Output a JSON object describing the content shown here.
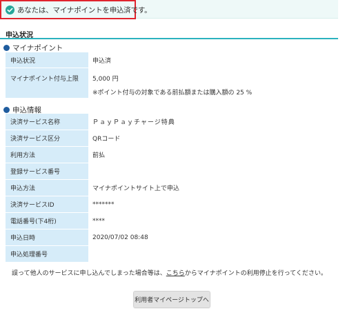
{
  "banner": {
    "message": "あなたは、マイナポイントを申込済です。"
  },
  "section_title": "申込状況",
  "mynapoint": {
    "heading": "マイナポイント",
    "rows": [
      {
        "label": "申込状況",
        "value": "申込済"
      },
      {
        "label": "マイナポイント付与上限",
        "value": "5,000 円",
        "note": "※ポイント付与の対象である前払額または購入額の 25 %"
      }
    ]
  },
  "application": {
    "heading": "申込情報",
    "rows": [
      {
        "label": "決済サービス名称",
        "value": "ＰａｙＰａｙチャージ特典"
      },
      {
        "label": "決済サービス区分",
        "value": "QRコード"
      },
      {
        "label": "利用方法",
        "value": "前払"
      },
      {
        "label": "登録サービス番号",
        "value": ""
      },
      {
        "label": "申込方法",
        "value": "マイナポイントサイト上で申込"
      },
      {
        "label": "決済サービスID",
        "value": "*******"
      },
      {
        "label": "電話番号(下4桁)",
        "value": "****"
      },
      {
        "label": "申込日時",
        "value": "2020/07/02 08:48"
      },
      {
        "label": "申込処理番号",
        "value": ""
      }
    ]
  },
  "footnote": {
    "before": "誤って他人のサービスに申し込んでしまった場合等は、",
    "link": "こちら",
    "after": "からマイナポイントの利用停止を行ってください。"
  },
  "mypage_button": "利用者マイページトップへ",
  "colors": {
    "accent": "#2ab2be",
    "label_bg": "#d6ecf9",
    "banner_bg": "#eef9f8",
    "banner_border": "#e0242d",
    "check": "#26a69a",
    "bullet": "#1f5c9e"
  }
}
